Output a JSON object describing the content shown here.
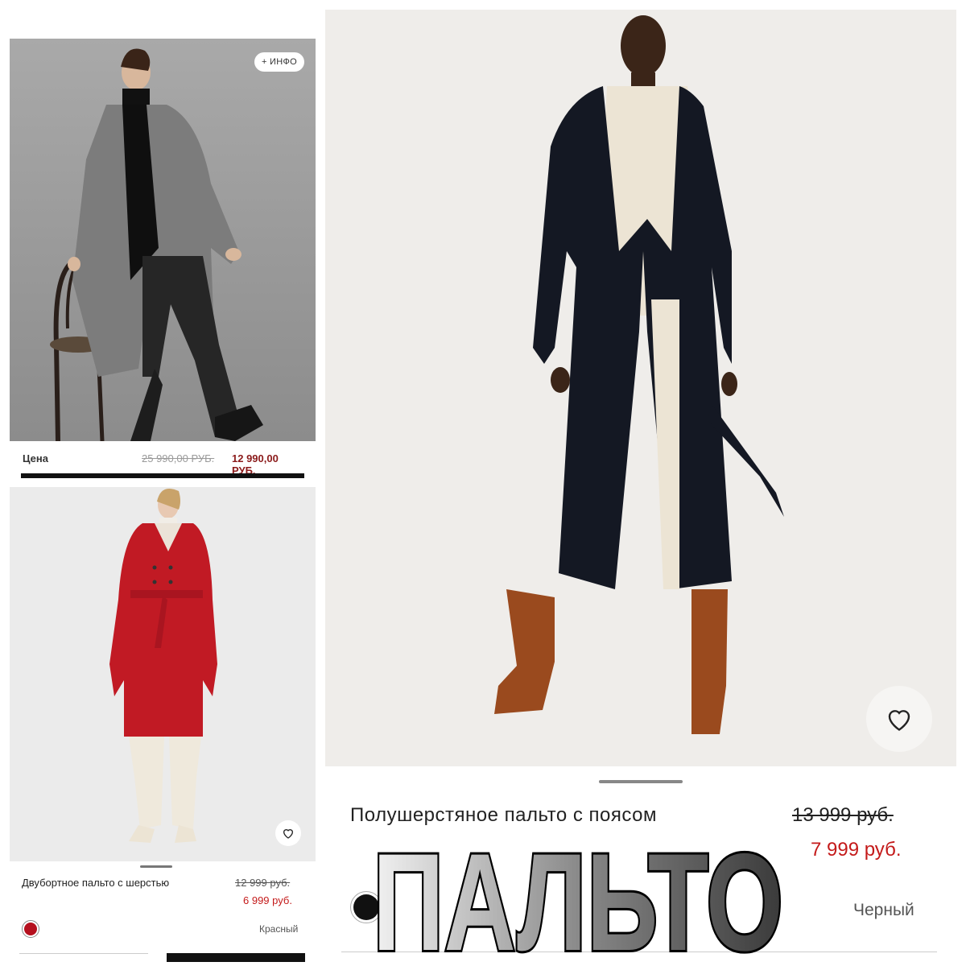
{
  "panel_grey": {
    "info_button": "+ ИНФО",
    "price_label": "Цена",
    "old_price": "25 990,00  РУБ.",
    "new_price": "12 990,00  РУБ."
  },
  "panel_red": {
    "product_name": "Двубортное пальто с шерстью",
    "old_price": "12 999 руб.",
    "new_price": "6 999 руб.",
    "color_name": "Красный",
    "swatch_color": "#b5101e"
  },
  "panel_black": {
    "product_name": "Полушерстяное пальто с поясом",
    "old_price": "13 999 руб.",
    "new_price": "7 999 руб.",
    "color_name": "Черный",
    "swatch_color": "#111111"
  },
  "overlay": {
    "title": "ПАЛЬТО"
  },
  "colors": {
    "sale_red": "#c41a1a",
    "sale_dark_red": "#8b1a1a",
    "black": "#111111"
  },
  "icons": [
    "heart-icon",
    "heart-icon"
  ]
}
